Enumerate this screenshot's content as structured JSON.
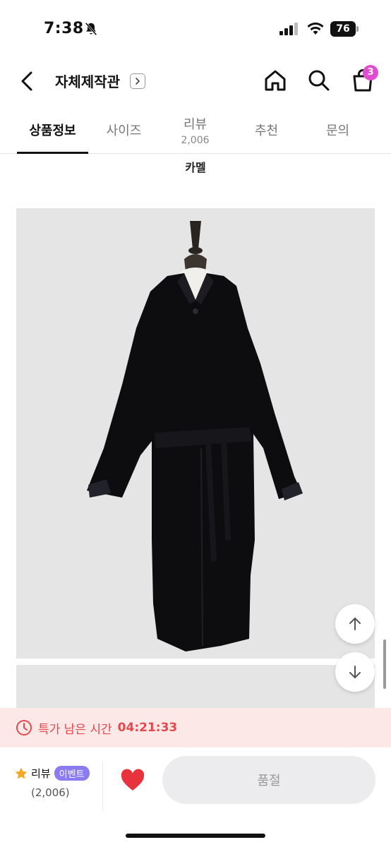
{
  "status_bar": {
    "time": "7:38",
    "battery": "76"
  },
  "header": {
    "title": "자체제작관",
    "cart_count": "3"
  },
  "tabs": [
    {
      "label": "상품정보",
      "count": ""
    },
    {
      "label": "사이즈",
      "count": ""
    },
    {
      "label": "리뷰",
      "count": "2,006"
    },
    {
      "label": "추천",
      "count": ""
    },
    {
      "label": "문의",
      "count": ""
    }
  ],
  "active_tab": "상품정보",
  "product": {
    "color_name": "카멜"
  },
  "timer": {
    "label": "특가 남은 시간",
    "value": "04:21:33"
  },
  "bottom_bar": {
    "review_label": "리뷰",
    "event_badge": "이벤트",
    "review_count": "(2,006)",
    "buy_button": "품절"
  },
  "colors": {
    "accent_pink": "#e04dd0",
    "timer_red": "#e5484d",
    "event_purple": "#8b7bf0",
    "heart_red": "#e8333c"
  }
}
